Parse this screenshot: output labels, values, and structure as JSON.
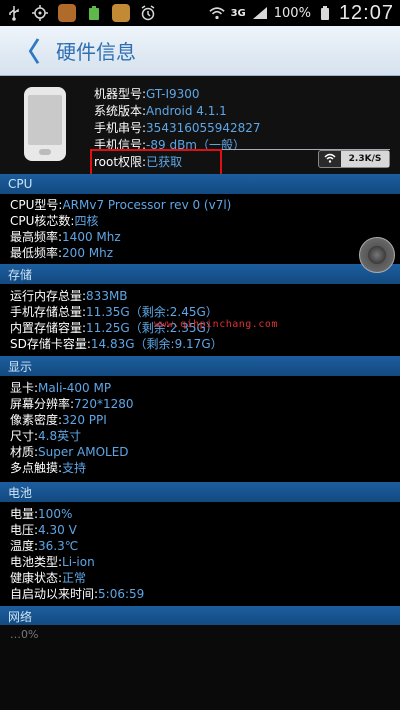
{
  "status_bar": {
    "network": "3G",
    "battery": "100%",
    "time": "12:07"
  },
  "title_bar": {
    "back": "〈",
    "title": "硬件信息"
  },
  "device": {
    "model_label": "机器型号:",
    "model": "GT-I9300",
    "os_label": "系统版本:",
    "os": "Android 4.1.1",
    "serial_label": "手机串号:",
    "serial": "354316055942827",
    "signal_label": "手机信号:",
    "signal": "-89 dBm（一般）",
    "root_label": "root权限:",
    "root": "已获取",
    "speed": "2.3K/S"
  },
  "cpu": {
    "header": "CPU",
    "rows": [
      {
        "k": "CPU型号:",
        "v": "ARMv7 Processor rev 0 (v7l)"
      },
      {
        "k": "CPU核芯数:",
        "v": "四核"
      },
      {
        "k": "最高频率:",
        "v": "1400 Mhz"
      },
      {
        "k": "最低频率:",
        "v": "200 Mhz"
      }
    ]
  },
  "storage": {
    "header": "存储",
    "rows": [
      {
        "k": "运行内存总量:",
        "v": "833MB"
      },
      {
        "k": "手机存储总量:",
        "v": "11.35G（剩余:2.45G）"
      },
      {
        "k": "内置存储容量:",
        "v": "11.25G（剩余:2.35G）"
      },
      {
        "k": "SD存储卡容量:",
        "v": "14.83G（剩余:9.17G）"
      }
    ],
    "watermark": "www.qihpinchang.com"
  },
  "display": {
    "header": "显示",
    "rows": [
      {
        "k": "显卡:",
        "v": "Mali-400 MP"
      },
      {
        "k": "屏幕分辨率:",
        "v": "720*1280"
      },
      {
        "k": "像素密度:",
        "v": "320 PPI"
      },
      {
        "k": "尺寸:",
        "v": "4.8英寸"
      },
      {
        "k": "材质:",
        "v": "Super AMOLED"
      },
      {
        "k": "多点触摸:",
        "v": "支持"
      }
    ]
  },
  "battery": {
    "header": "电池",
    "rows": [
      {
        "k": "电量:",
        "v": "100%"
      },
      {
        "k": "电压:",
        "v": "4.30 V"
      },
      {
        "k": "温度:",
        "v": "36.3℃"
      },
      {
        "k": "电池类型:",
        "v": "Li-ion"
      },
      {
        "k": "健康状态:",
        "v": "正常"
      },
      {
        "k": "自启动以来时间:",
        "v": "5:06:59"
      }
    ]
  },
  "network": {
    "header": "网络",
    "partial": "…0%"
  }
}
